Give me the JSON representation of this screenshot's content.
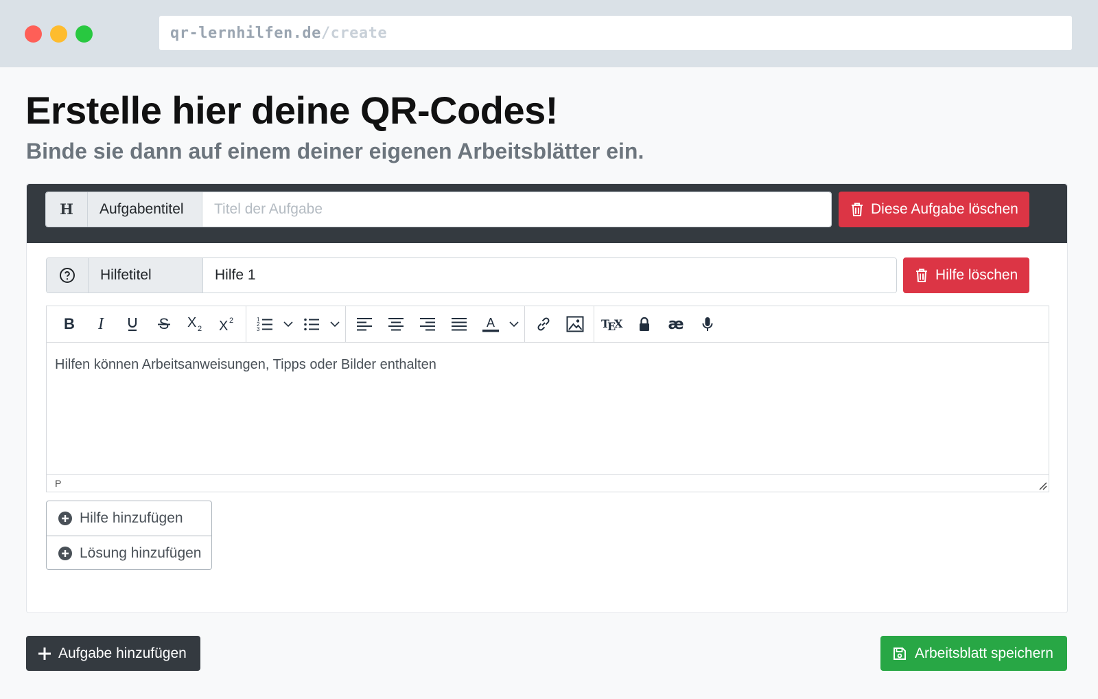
{
  "browser": {
    "url_host": "qr-lernhilfen.de",
    "url_path": "/create"
  },
  "page": {
    "title": "Erstelle hier deine QR-Codes!",
    "subtitle": "Binde sie dann auf einem deiner eigenen Arbeitsblätter ein."
  },
  "task": {
    "title_addon_icon": "heading-icon",
    "title_label": "Aufgabentitel",
    "title_placeholder": "Titel der Aufgabe",
    "title_value": "",
    "delete_label": "Diese Aufgabe löschen"
  },
  "hint": {
    "addon_icon": "question-circle-icon",
    "title_label": "Hilfetitel",
    "title_value": "Hilfe 1",
    "delete_label": "Hilfe löschen"
  },
  "editor": {
    "toolbar_groups": [
      [
        "bold-icon",
        "italic-icon",
        "underline-icon",
        "strikethrough-icon",
        "subscript-icon",
        "superscript-icon"
      ],
      [
        "numbered-list-icon",
        "bullet-list-icon"
      ],
      [
        "align-left-icon",
        "align-center-icon",
        "align-right-icon",
        "align-justify-icon",
        "text-color-icon"
      ],
      [
        "link-icon",
        "image-icon"
      ],
      [
        "tex-icon",
        "lock-icon",
        "ae-ligature-icon",
        "microphone-icon"
      ]
    ],
    "content": "Hilfen können Arbeitsanweisungen, Tipps oder Bilder enthalten",
    "status_path": "P"
  },
  "add_menu": {
    "add_hint_label": "Hilfe hinzufügen",
    "add_solution_label": "Lösung hinzufügen"
  },
  "footer": {
    "add_task_label": "Aufgabe hinzufügen",
    "save_label": "Arbeitsblatt speichern"
  },
  "colors": {
    "danger": "#dc3545",
    "dark": "#343a40",
    "success": "#28a745"
  }
}
